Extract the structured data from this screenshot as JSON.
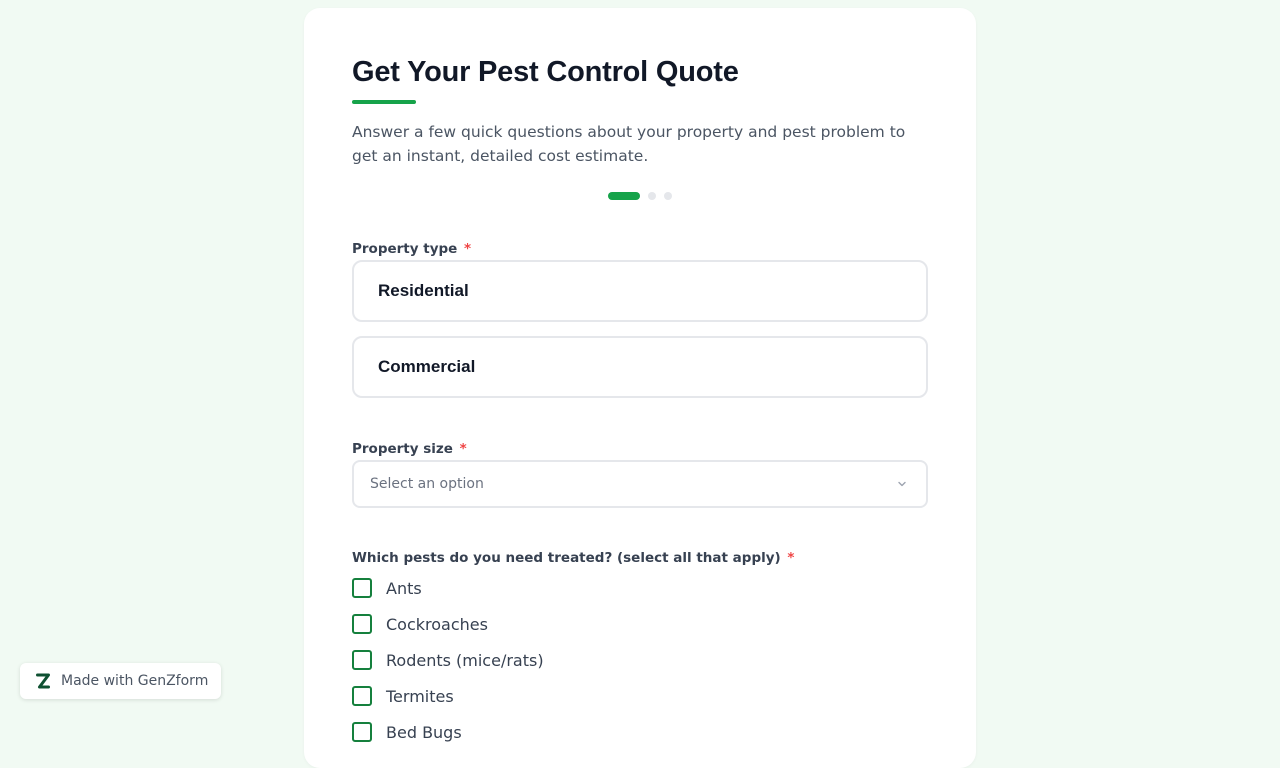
{
  "form": {
    "title": "Get Your Pest Control Quote",
    "subtitle": "Answer a few quick questions about your property and pest problem to get an instant, detailed cost estimate.",
    "progress": {
      "current_step": 1,
      "total_steps": 3
    },
    "property_type": {
      "label": "Property type",
      "required_mark": "*",
      "options": [
        "Residential",
        "Commercial"
      ]
    },
    "property_size": {
      "label": "Property size",
      "required_mark": "*",
      "placeholder": "Select an option"
    },
    "pests": {
      "label": "Which pests do you need treated? (select all that apply)",
      "required_mark": "*",
      "options": [
        "Ants",
        "Cockroaches",
        "Rodents (mice/rats)",
        "Termites",
        "Bed Bugs"
      ]
    }
  },
  "badge": {
    "logo_letter": "Z",
    "text": "Made with GenZform"
  },
  "colors": {
    "accent": "#16a34a",
    "page_background": "#f1faf3",
    "required": "#ef4444",
    "logo": "#0f5132"
  },
  "icons": {
    "select_chevron": "chevron-down-icon",
    "badge_logo": "genzform-logo-icon"
  }
}
